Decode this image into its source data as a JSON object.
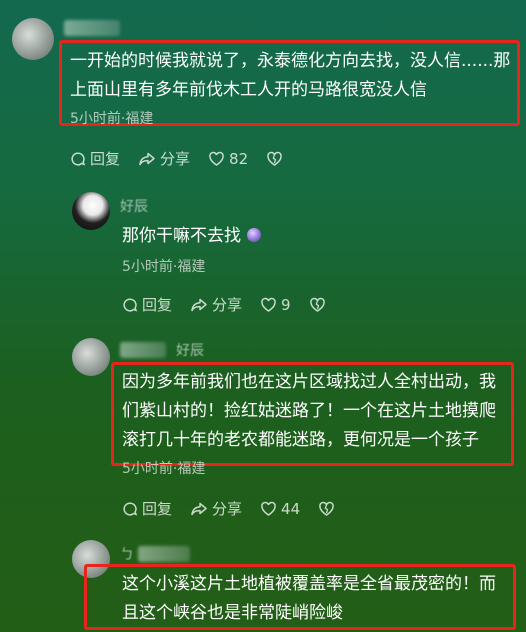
{
  "comments": [
    {
      "text_lines": [
        "一开始的时候我就说了，永泰德化方向去找，没人信......那",
        "上面山里有多年前伐木工人开的马路很宽没人信"
      ],
      "meta": "5小时前·福建",
      "reply": "回复",
      "share": "分享",
      "likes": "82"
    },
    {
      "username": "好辰",
      "text": "那你干嘛不去找",
      "meta": "5小时前·福建",
      "reply": "回复",
      "share": "分享",
      "likes": "9"
    },
    {
      "username": "好辰",
      "text_lines": [
        "因为多年前我们也在这片区域找过人全村出动，我",
        "们紫山村的！捡红姑迷路了！一个在这片土地摸爬",
        "滚打几十年的老农都能迷路，更何况是一个孩子"
      ],
      "meta": "5小时前·福建",
      "reply": "回复",
      "share": "分享",
      "likes": "44"
    },
    {
      "username": "ㄅ",
      "text_lines": [
        "这个小溪这片土地植被覆盖率是全省最茂密的！而",
        "且这个峡谷也是非常陡峭险峻"
      ]
    }
  ],
  "colors": {
    "highlight_border": "#e8251c"
  }
}
